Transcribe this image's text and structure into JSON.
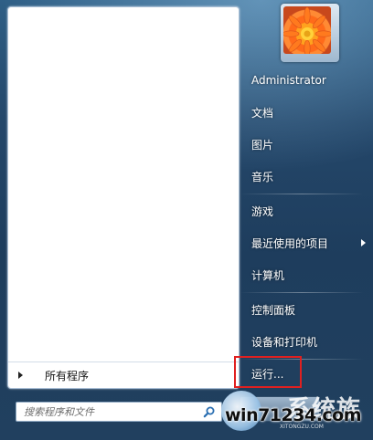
{
  "user": {
    "name": "Administrator",
    "avatar_icon": "flower-avatar-icon"
  },
  "left_pane": {
    "all_programs_label": "所有程序"
  },
  "search": {
    "placeholder": "搜索程序和文件",
    "icon": "search-icon"
  },
  "right_menu": {
    "documents": "文档",
    "pictures": "图片",
    "music": "音乐",
    "games": "游戏",
    "recent_items": "最近使用的项目",
    "computer": "计算机",
    "control_panel": "控制面板",
    "devices_printers": "设备和打印机",
    "run": "运行..."
  },
  "watermark": {
    "top_text": "系统族",
    "text": "win71234.com",
    "sub": "XITONGZU.COM"
  },
  "colors": {
    "highlight_border": "#e02020",
    "menu_text": "#ffffff",
    "background": "#24476a"
  }
}
